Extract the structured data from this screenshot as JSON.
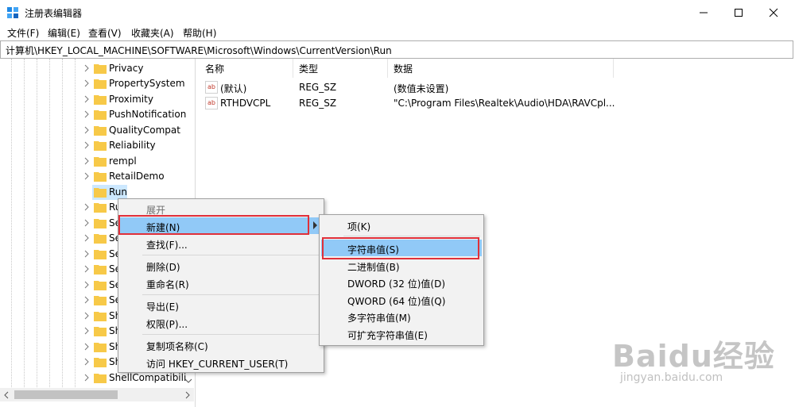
{
  "window": {
    "title": "注册表编辑器"
  },
  "menu": [
    "文件(F)",
    "编辑(E)",
    "查看(V)",
    "收藏夹(A)",
    "帮助(H)"
  ],
  "address": "计算机\\HKEY_LOCAL_MACHINE\\SOFTWARE\\Microsoft\\Windows\\CurrentVersion\\Run",
  "tree": {
    "items": [
      "Privacy",
      "PropertySystem",
      "Proximity",
      "PushNotification",
      "QualityCompat",
      "Reliability",
      "rempl",
      "RetailDemo",
      "Run",
      "Ru",
      "Se",
      "Se",
      "Se",
      "Se",
      "Se",
      "Se",
      "Sh",
      "Sh",
      "Sh",
      "Sh",
      "ShellCompatibili"
    ],
    "selected": "Run"
  },
  "columns": {
    "name": "名称",
    "type": "类型",
    "data": "数据"
  },
  "values": [
    {
      "name": "(默认)",
      "type": "REG_SZ",
      "data": "(数值未设置)"
    },
    {
      "name": "RTHDVCPL",
      "type": "REG_SZ",
      "data": "\"C:\\Program Files\\Realtek\\Audio\\HDA\\RAVCpl..."
    }
  ],
  "context_menu": {
    "expand": "展开",
    "new": "新建(N)",
    "find": "查找(F)...",
    "delete": "删除(D)",
    "rename": "重命名(R)",
    "export": "导出(E)",
    "permissions": "权限(P)...",
    "copy_key_name": "复制项名称(C)",
    "visit": "访问 HKEY_CURRENT_USER(T)"
  },
  "submenu": {
    "key": "项(K)",
    "string": "字符串值(S)",
    "binary": "二进制值(B)",
    "dword": "DWORD (32 位)值(D)",
    "qword": "QWORD (64 位)值(Q)",
    "multi_string": "多字符串值(M)",
    "expand_string": "可扩充字符串值(E)"
  },
  "watermark": {
    "main": "Baidu经验",
    "sub": "jingyan.baidu.com"
  },
  "colors": {
    "highlight": "#91c9f7",
    "selection": "#cce8ff",
    "annotation_red": "#e0303a"
  }
}
